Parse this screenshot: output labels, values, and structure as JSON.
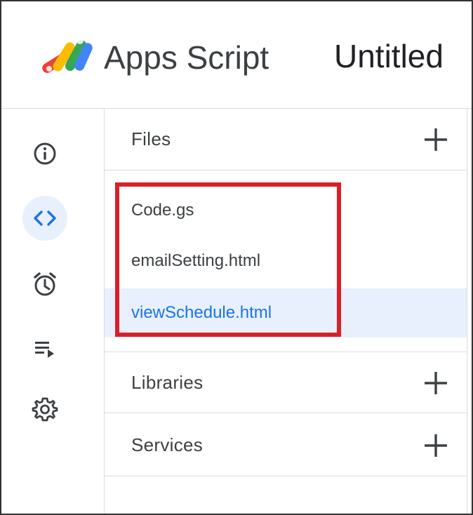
{
  "header": {
    "app_name": "Apps Script",
    "project_title": "Untitled"
  },
  "rail": {
    "items": [
      {
        "icon": "info-icon",
        "label": "Overview"
      },
      {
        "icon": "code-icon",
        "label": "Editor",
        "active": true
      },
      {
        "icon": "alarm-clock-icon",
        "label": "Triggers"
      },
      {
        "icon": "executions-icon",
        "label": "Executions"
      },
      {
        "icon": "gear-icon",
        "label": "Project Settings"
      }
    ]
  },
  "panel": {
    "files": {
      "label": "Files",
      "items": [
        "Code.gs",
        "emailSetting.html",
        "viewSchedule.html"
      ],
      "selected": "viewSchedule.html"
    },
    "libraries": {
      "label": "Libraries"
    },
    "services": {
      "label": "Services"
    }
  },
  "colors": {
    "accent": "#1a73e8",
    "selected_bg": "#e8f0fe",
    "highlight": "#d8202a",
    "text": "#3c4043",
    "divider": "#dadce0"
  }
}
